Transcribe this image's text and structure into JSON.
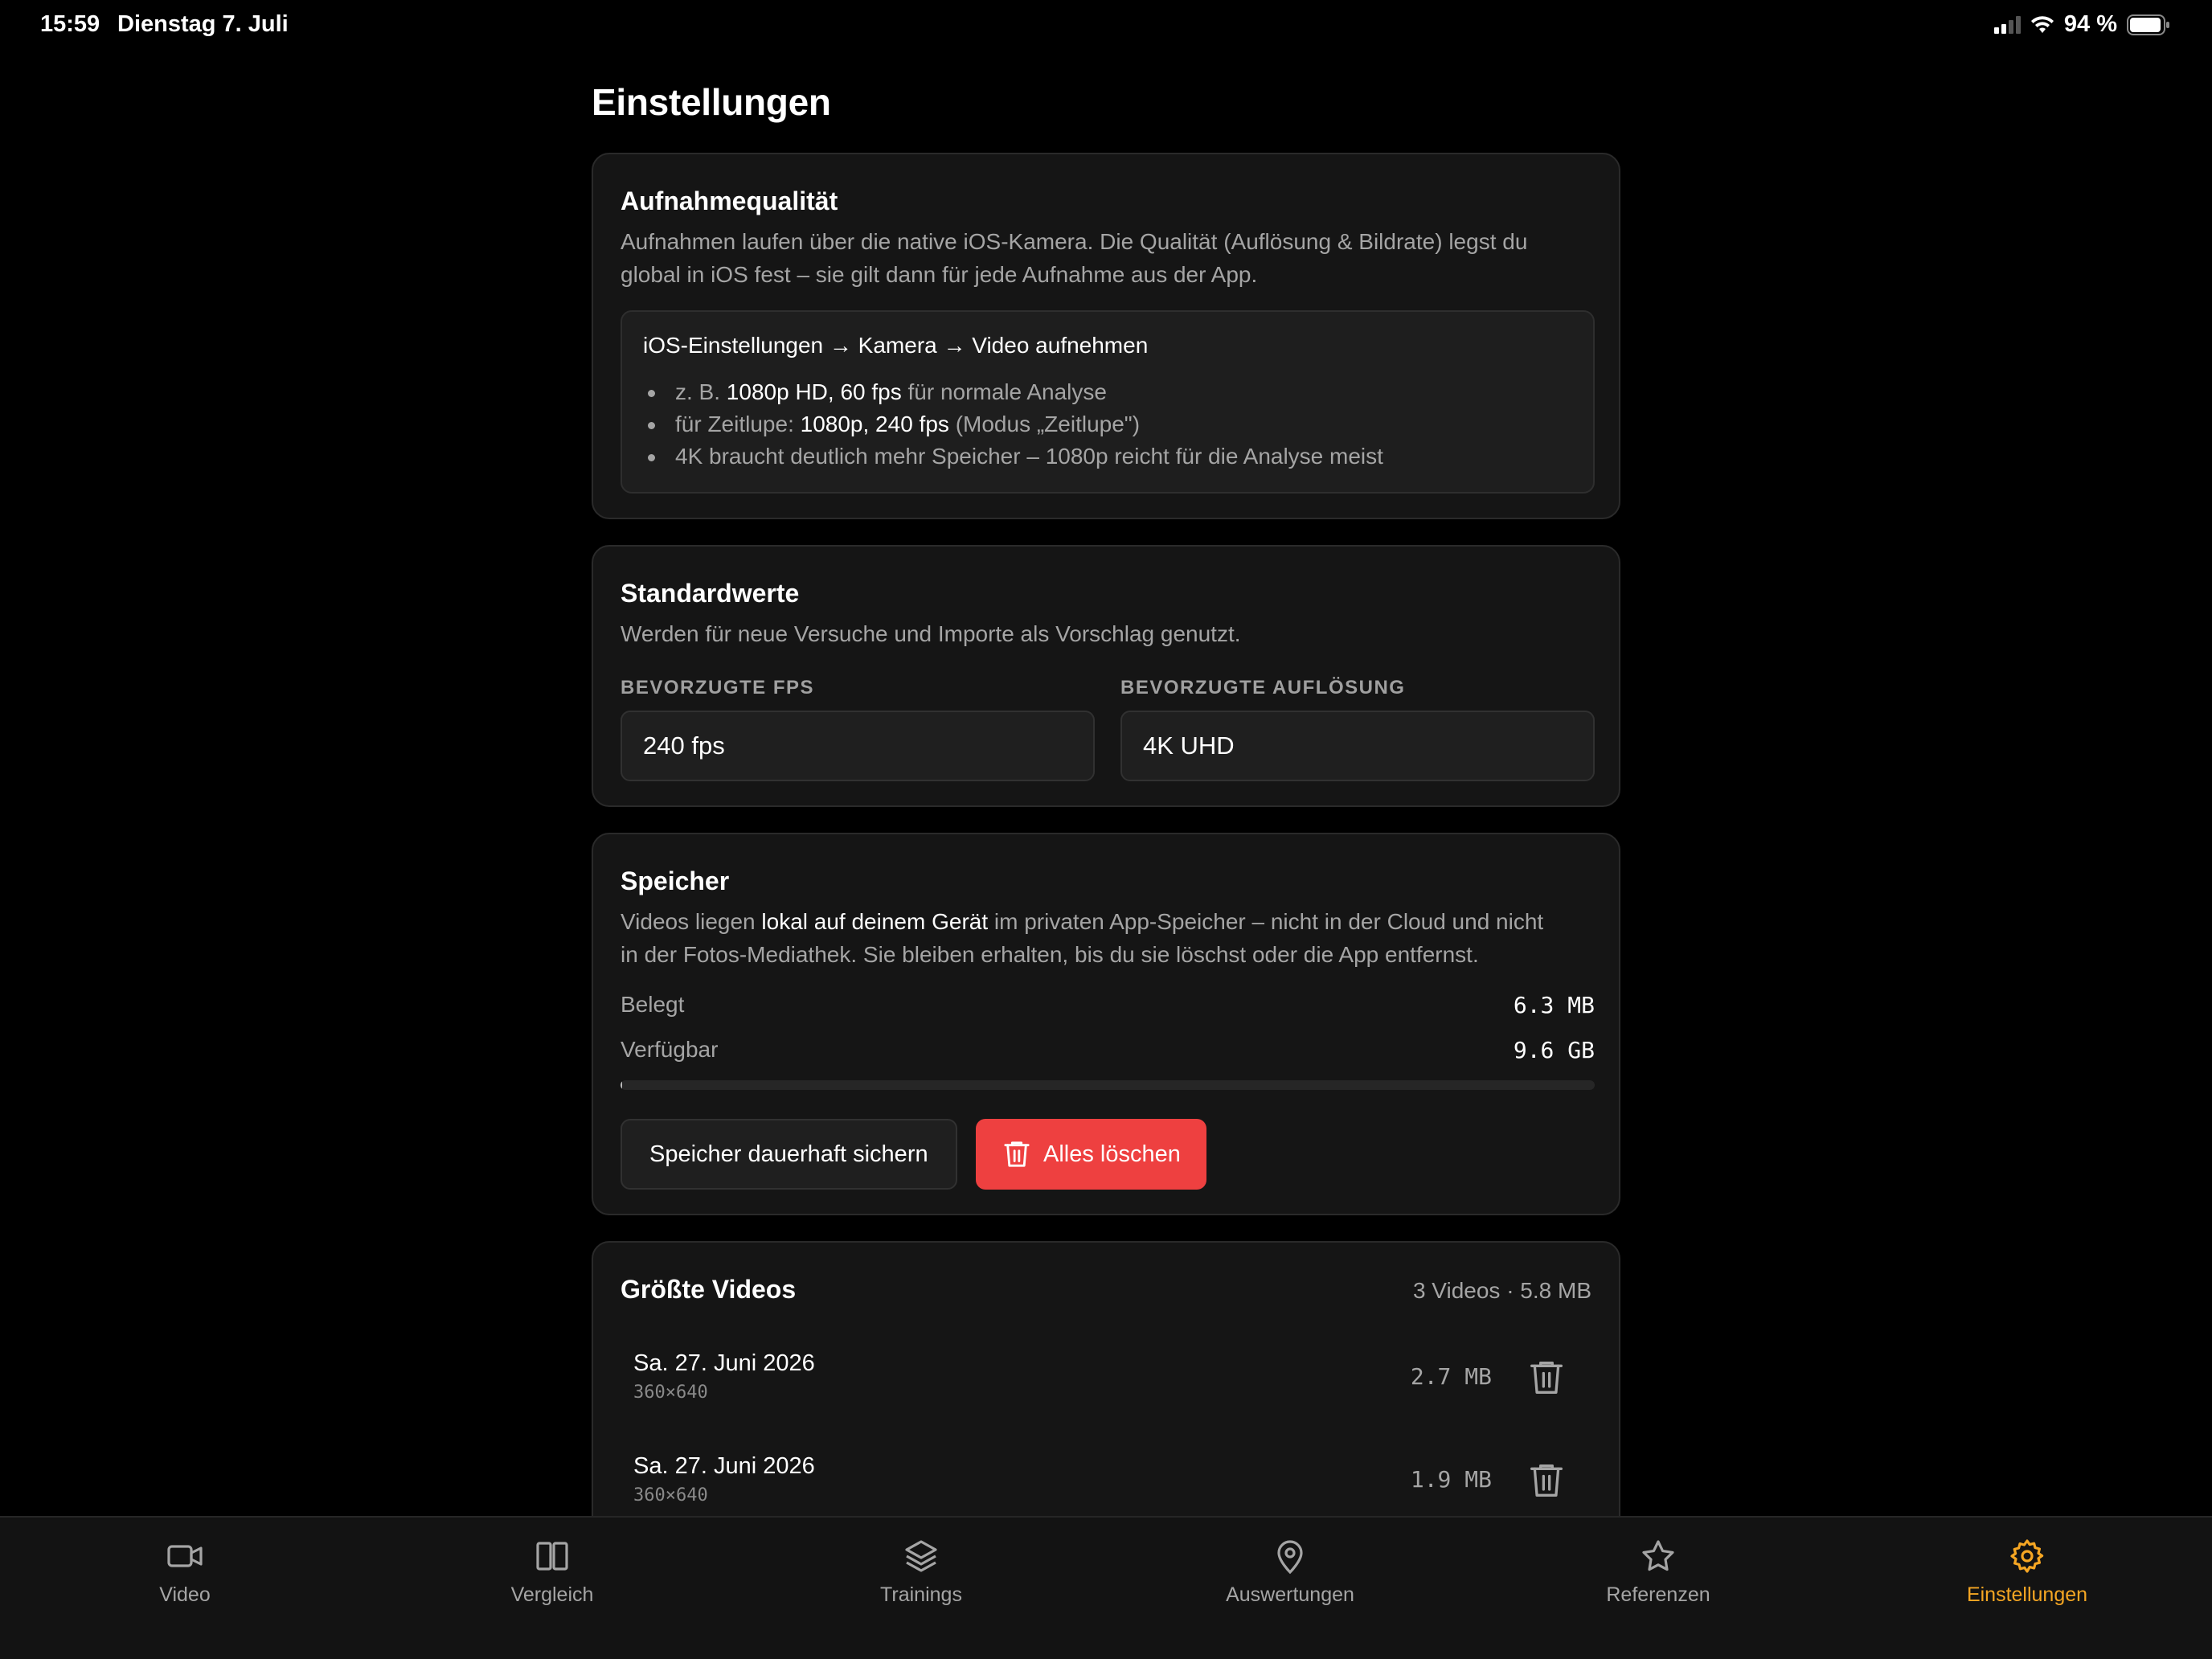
{
  "status_bar": {
    "time": "15:59",
    "date": "Dienstag 7. Juli",
    "battery": "94 %"
  },
  "page_title": "Einstellungen",
  "quality": {
    "title": "Aufnahmequalität",
    "desc_line1": "Aufnahmen laufen über die native iOS-Kamera. Die Qualität (Auflösung & Bildrate) legst du",
    "desc_line2": "global in iOS fest – sie gilt dann für jede Aufnahme aus der App.",
    "path": "iOS-Einstellungen → Kamera → Video aufnehmen",
    "tips": [
      {
        "pre": "z. B. ",
        "bold": "1080p HD, 60 fps",
        "post": " für normale Analyse"
      },
      {
        "pre": "für Zeitlupe: ",
        "bold": "1080p, 240 fps",
        "post": " (Modus „Zeitlupe\")"
      },
      {
        "pre": "4K braucht deutlich mehr Speicher – 1080p reicht für die Analyse meist",
        "bold": "",
        "post": ""
      }
    ]
  },
  "defaults": {
    "title": "Standardwerte",
    "desc": "Werden für neue Versuche und Importe als Vorschlag genutzt.",
    "fps_label": "BEVORZUGTE FPS",
    "fps_value": "240 fps",
    "res_label": "BEVORZUGTE AUFLÖSUNG",
    "res_value": "4K UHD"
  },
  "storage": {
    "title": "Speicher",
    "desc_pre": "Videos liegen ",
    "desc_bold": "lokal auf deinem Gerät",
    "desc_post": " im privaten App-Speicher – nicht in der Cloud und nicht",
    "desc_line2": "in der Fotos-Mediathek. Sie bleiben erhalten, bis du sie löschst oder die App entfernst.",
    "used_label": "Belegt",
    "used_value": "6.3 MB",
    "avail_label": "Verfügbar",
    "avail_value": "9.6 GB",
    "usage_fraction": 0.0006,
    "persist_button": "Speicher dauerhaft sichern",
    "delete_all_button": "Alles löschen"
  },
  "largest_videos": {
    "title": "Größte Videos",
    "summary": "3 Videos · 5.8 MB",
    "items": [
      {
        "date": "Sa. 27. Juni 2026",
        "resolution": "360×640",
        "size": "2.7 MB"
      },
      {
        "date": "Sa. 27. Juni 2026",
        "resolution": "360×640",
        "size": "1.9 MB"
      }
    ]
  },
  "tabs": [
    {
      "label": "Video",
      "icon": "video-camera-icon"
    },
    {
      "label": "Vergleich",
      "icon": "split-columns-icon"
    },
    {
      "label": "Trainings",
      "icon": "layers-icon"
    },
    {
      "label": "Auswertungen",
      "icon": "map-pin-icon"
    },
    {
      "label": "Referenzen",
      "icon": "star-icon"
    },
    {
      "label": "Einstellungen",
      "icon": "gear-icon"
    }
  ],
  "colors": {
    "accent": "#f5a623",
    "danger": "#ee4040",
    "card": "#151515"
  }
}
